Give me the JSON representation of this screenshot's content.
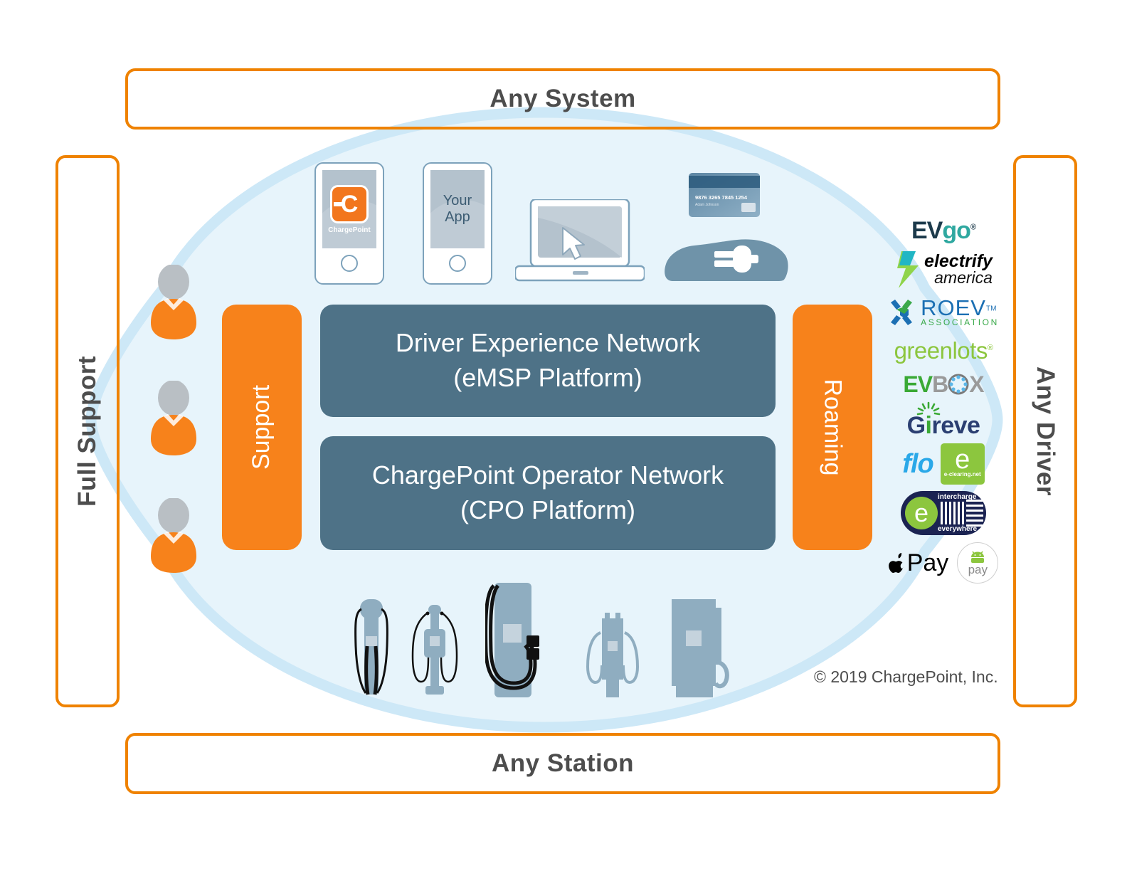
{
  "frames": {
    "top": "Any System",
    "bottom": "Any Station",
    "left": "Full Support",
    "right": "Any Driver"
  },
  "platforms": [
    {
      "line1": "Driver Experience Network",
      "line2": "(eMSP Platform)"
    },
    {
      "line1": "ChargePoint Operator Network",
      "line2": "(CPO Platform)"
    }
  ],
  "pills": {
    "support": "Support",
    "roaming": "Roaming"
  },
  "devices": {
    "chargepoint_phone": {
      "app_label": "ChargePoint",
      "icon_letter": "C"
    },
    "your_app_phone": {
      "line1": "Your",
      "line2": "App"
    },
    "credit_card": {
      "number": "9876 3265 7845 1254",
      "name": "Adam Johnson"
    }
  },
  "logos": [
    {
      "name": "EVgo",
      "part1": "EV",
      "part2": "go",
      "mark": "®"
    },
    {
      "name": "Electrify America",
      "part1": "electrify",
      "part2": "america"
    },
    {
      "name": "ROEV Association",
      "part1": "ROEV",
      "mark": "TM",
      "part2": "ASSOCIATION"
    },
    {
      "name": "greenlots",
      "part1": "greenlots",
      "mark": "®"
    },
    {
      "name": "EVBOX",
      "part1": "EV",
      "part2": "B",
      "part3": "X"
    },
    {
      "name": "Gireve",
      "part1": "G",
      "part2": "i",
      "part3": "reve"
    },
    {
      "name": "flo",
      "part1": "flo"
    },
    {
      "name": "e-clearing.net",
      "part1": "e",
      "part2": "e-clearing.net"
    },
    {
      "name": "intercharge everywhere",
      "part1": "intercharge",
      "part2": "everywhere",
      "part3": "e"
    },
    {
      "name": "Apple Pay",
      "part1": "",
      "part2": "Pay"
    },
    {
      "name": "Android Pay",
      "part1": "pay"
    }
  ],
  "copyright": "© 2019 ChargePoint, Inc.",
  "colors": {
    "orange_frame": "#ef8200",
    "orange_pill": "#f7821b",
    "platform_blue": "#4e7287",
    "cloud_fill": "#e7f4fb",
    "cloud_stroke": "#cde8f7",
    "device_gray": "#7f9cb0",
    "label_gray": "#4d4d4d"
  }
}
